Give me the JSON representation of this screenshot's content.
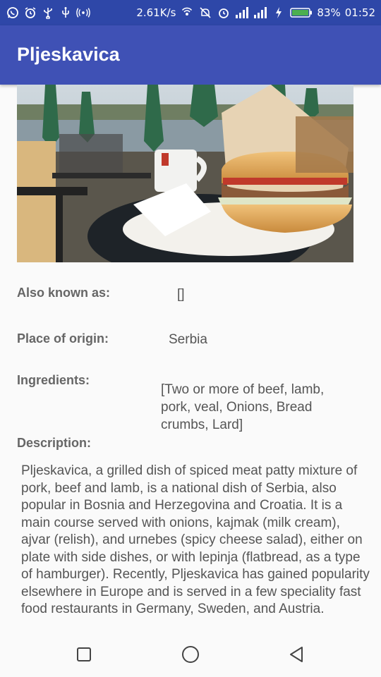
{
  "status_bar": {
    "network_speed": "2.61K/s",
    "battery": "83%",
    "time": "01:52",
    "left_icons": [
      "whatsapp-icon",
      "alarm-icon",
      "usb-icon",
      "usb-debug-icon",
      "hotspot-icon"
    ],
    "right_icons": [
      "hotspot-icon",
      "mute-icon",
      "alarm-icon",
      "signal-icon",
      "signal-icon",
      "charging-icon",
      "battery-icon"
    ]
  },
  "app_bar": {
    "title": "Pljeskavica"
  },
  "hero_image": {
    "subject": "pljeskavica burger on plate at waterfront cafe"
  },
  "details": {
    "also_known_as_label": "Also known as:",
    "also_known_as_value": "[]",
    "place_of_origin_label": "Place of origin:",
    "place_of_origin_value": "Serbia",
    "ingredients_label": "Ingredients:",
    "ingredients_value": "[Two or more of beef, lamb, pork, veal, Onions, Bread crumbs, Lard]",
    "description_label": "Description:",
    "description_value": "Pljeskavica, a grilled dish of spiced meat patty mixture of pork, beef and lamb, is a national dish of Serbia, also popular in Bosnia and Herzegovina and Croatia. It is a main course served with onions, kajmak (milk cream), ajvar (relish), and urnebes (spicy cheese salad), either on plate with side dishes, or with lepinja (flatbread, as a type of hamburger). Recently, Pljeskavica has gained popularity elsewhere in Europe and is served in a few speciality fast food restaurants in Germany, Sweden, and Austria."
  },
  "nav_bar": {
    "icons": [
      "recents-icon",
      "home-icon",
      "back-icon"
    ]
  },
  "colors": {
    "status_bar": "#2e47a8",
    "app_bar": "#3f51b5",
    "background": "#fafafa",
    "text": "#555555"
  }
}
